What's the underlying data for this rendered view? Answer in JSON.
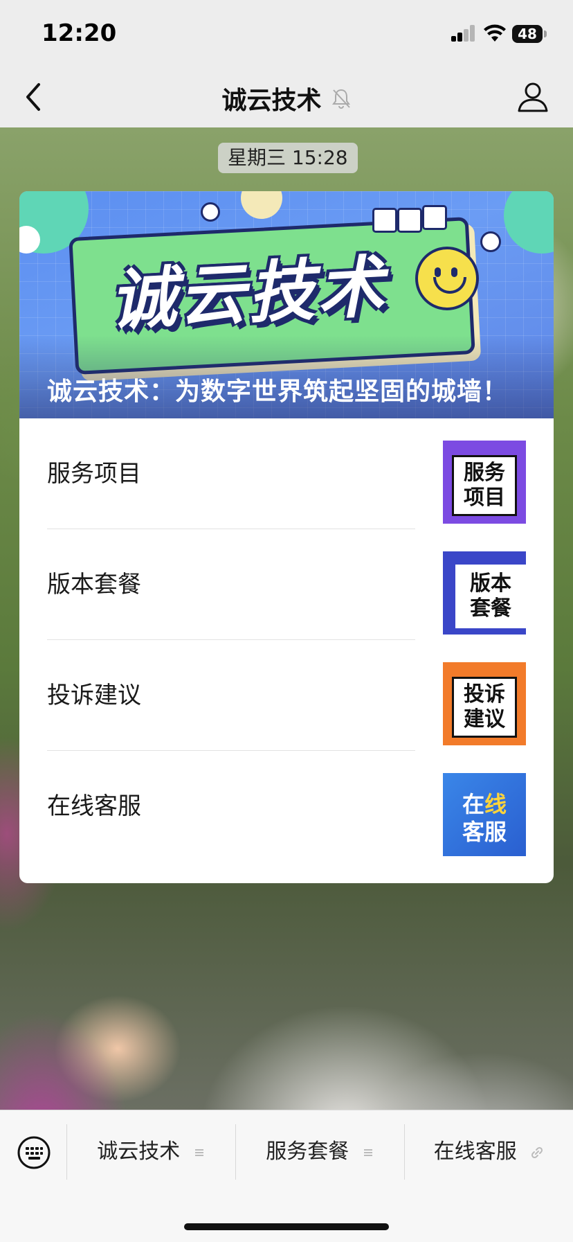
{
  "status_bar": {
    "time": "12:20",
    "battery": "48"
  },
  "nav": {
    "title": "诚云技术"
  },
  "chat": {
    "timestamp": "星期三 15:28"
  },
  "article": {
    "banner_logo": "诚云技术",
    "caption": "诚云技术：为数字世界筑起坚固的城墙！",
    "items": [
      {
        "label": "服务项目",
        "thumb_line1": "服务",
        "thumb_line2": "项目"
      },
      {
        "label": "版本套餐",
        "thumb_line1": "版本",
        "thumb_line2": "套餐"
      },
      {
        "label": "投诉建议",
        "thumb_line1": "投诉",
        "thumb_line2": "建议"
      },
      {
        "label": "在线客服",
        "thumb_line1a": "在",
        "thumb_line1b": "线",
        "thumb_line2": "客服"
      }
    ]
  },
  "bottom_menu": {
    "items": [
      {
        "label": "诚云技术",
        "icon": "menu-lines-icon"
      },
      {
        "label": "服务套餐",
        "icon": "menu-lines-icon"
      },
      {
        "label": "在线客服",
        "icon": "link-icon"
      }
    ]
  }
}
